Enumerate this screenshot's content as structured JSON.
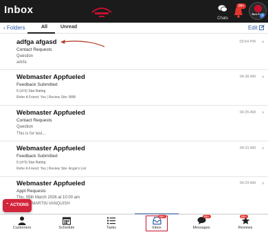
{
  "header": {
    "title": "Inbox",
    "chats_label": "Chats",
    "notification_badge": "99+",
    "avatar_text": "Ren Fuel"
  },
  "tabs": {
    "back_label": "Folders",
    "all_label": "All",
    "unread_label": "Unread",
    "edit_label": "Edit"
  },
  "messages": [
    {
      "name": "adfga afgasd",
      "type": "Contact Requests",
      "line3": "Question",
      "line4": "adsfa",
      "time": "03:54 PM"
    },
    {
      "name": "Webmaster Appfueled",
      "type": "Feedback Submitted",
      "line3": "5 (of 5) Star Rating",
      "line4": "Refer A Friend: Yes  |  Review Site: BBB",
      "time": "04:38 AM"
    },
    {
      "name": "Webmaster Appfueled",
      "type": "Contact Requests",
      "line3": "Question",
      "line4": "This is for test...",
      "time": "04:35 AM"
    },
    {
      "name": "Webmaster Appfueled",
      "type": "Feedback Submitted",
      "line3": "5 (of 5) Star Rating",
      "line4": "Refer A Friend: Yes  |  Review Site: Angie's List",
      "time": "04:31 AM"
    },
    {
      "name": "Webmaster Appfueled",
      "type": "Appt Requests",
      "line3": "Thu, 05th March 2026 at 10:00 am",
      "line4": "ASTON MARTIN VANQUISH",
      "time": "04:29 AM"
    }
  ],
  "actions_label": "ACTIONS",
  "bottom_nav": [
    {
      "label": "Customers",
      "icon": "person-icon"
    },
    {
      "label": "Schedule",
      "icon": "calendar-icon"
    },
    {
      "label": "Tasks",
      "icon": "list-icon"
    },
    {
      "label": "Inbox",
      "icon": "inbox-icon",
      "badge": "99+"
    },
    {
      "label": "Messages",
      "icon": "chat-icon",
      "badge": "99+"
    },
    {
      "label": "Reviews",
      "icon": "star-icon",
      "badge": "99+"
    }
  ],
  "colors": {
    "header": "#1b1b1b",
    "accent_red": "#d4243b",
    "link_blue": "#2f5aa8"
  }
}
